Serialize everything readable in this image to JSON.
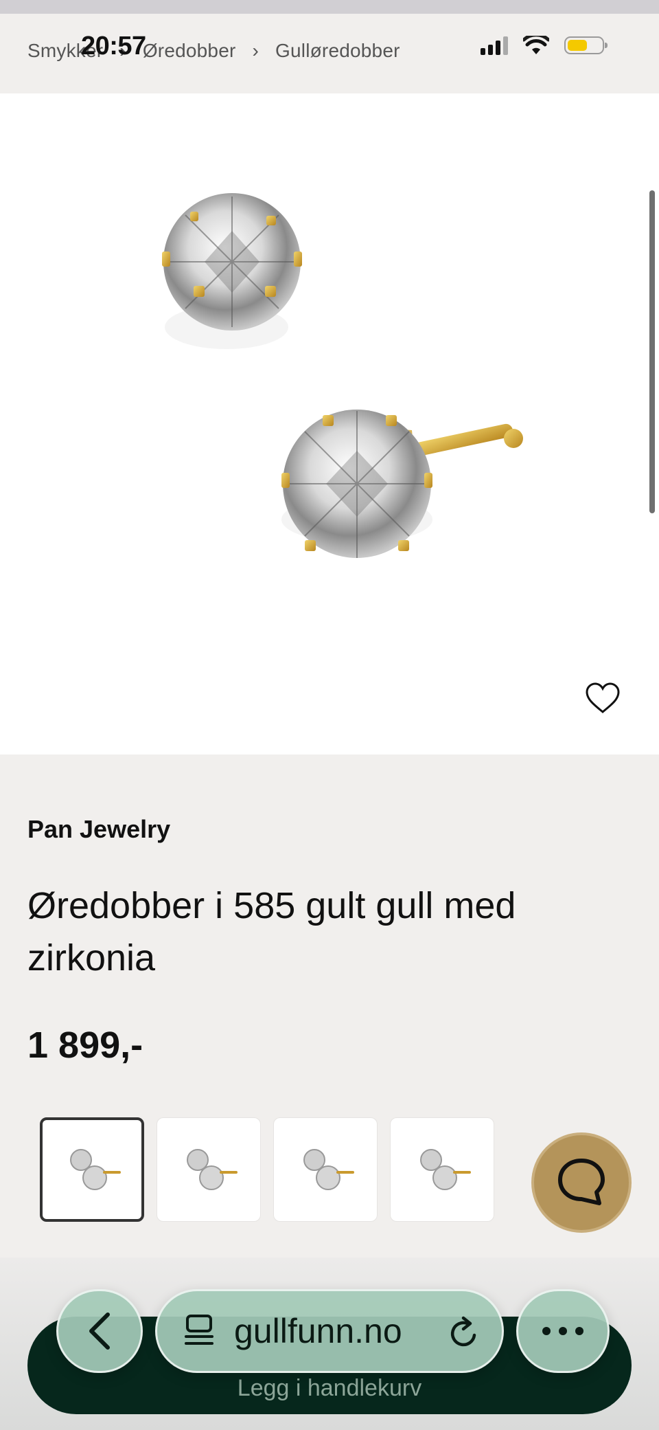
{
  "status_bar": {
    "time": "20:57",
    "icons": [
      "cellular-signal-icon",
      "wifi-icon",
      "battery-icon"
    ],
    "battery_color": "#f4c900"
  },
  "breadcrumb": {
    "items": [
      "Smykker",
      "Øredobber",
      "Gulløredobber"
    ]
  },
  "product": {
    "brand": "Pan Jewelry",
    "title": "Øredobber i 585 gult gull med zirkonia",
    "price": "1 899,-",
    "image_alt": "Gold stud earrings with zirconia",
    "favorite_icon": "heart-icon",
    "thumbnails": [
      {
        "selected": true
      },
      {
        "selected": false
      },
      {
        "selected": false
      },
      {
        "selected": false
      }
    ]
  },
  "chat": {
    "icon": "chat-bubble-icon",
    "color": "#b4945a"
  },
  "cart_button": {
    "label": "Legg i handlekurv",
    "color": "#06271c"
  },
  "browser_bar": {
    "back_icon": "chevron-left-icon",
    "url": "gullfunn.no",
    "tabs_icon": "reader-icon",
    "reload_icon": "reload-icon",
    "more_icon": "ellipsis-icon"
  }
}
